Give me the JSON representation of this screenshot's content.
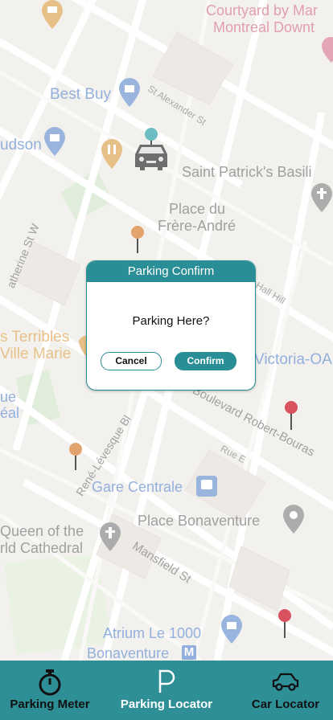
{
  "map": {
    "labels": {
      "courtyard_1": "Courtyard by Mar",
      "courtyard_2": "Montreal Downt",
      "best_buy": "Best Buy",
      "st_alexander": "St Alexander St",
      "hudson": "udson",
      "saint_patricks": "Saint Patrick's Basili",
      "place_du": "Place du",
      "frere_andre": "Frère-André",
      "catherine": "atherine St W",
      "hall_hill": "r Hall Hill",
      "terribles": "s Terribles",
      "ville_marie": "Ville Marie",
      "victoria": "Victoria-OA",
      "ue": "ue",
      "eal": "éal",
      "boulevard": "Boulevard Robert-Bouras",
      "rue_e": "Rue E",
      "rene_levesque": "René-Lévesque Bl",
      "gare_centrale": "Gare Centrale",
      "place_bonaventure": "Place Bonaventure",
      "queen_1": "Queen of the",
      "queen_2": "rld Cathedral",
      "mansfield": "Mansfield St",
      "atrium": "Atrium Le 1000",
      "bonaventure": "Bonaventure",
      "metro": "M"
    },
    "colors": {
      "poi_blue": "#5b86c9",
      "poi_pink": "#d3708b",
      "poi_gray": "#7a7a7a",
      "poi_orange": "#d99a3e"
    }
  },
  "dialog": {
    "title": "Parking Confirm",
    "message": "Parking Here?",
    "cancel_label": "Cancel",
    "confirm_label": "Confirm"
  },
  "nav": {
    "items": [
      {
        "label": "Parking Meter",
        "icon": "stopwatch-icon",
        "active": false
      },
      {
        "label": "Parking Locator",
        "icon": "parking-p-icon",
        "active": true
      },
      {
        "label": "Car Locator",
        "icon": "car-icon",
        "active": false
      }
    ]
  },
  "colors": {
    "accent": "#2f8f97",
    "pin_teal": "#6cbcc2",
    "pin_orange": "#e3a36c",
    "pin_red": "#d9525f"
  }
}
